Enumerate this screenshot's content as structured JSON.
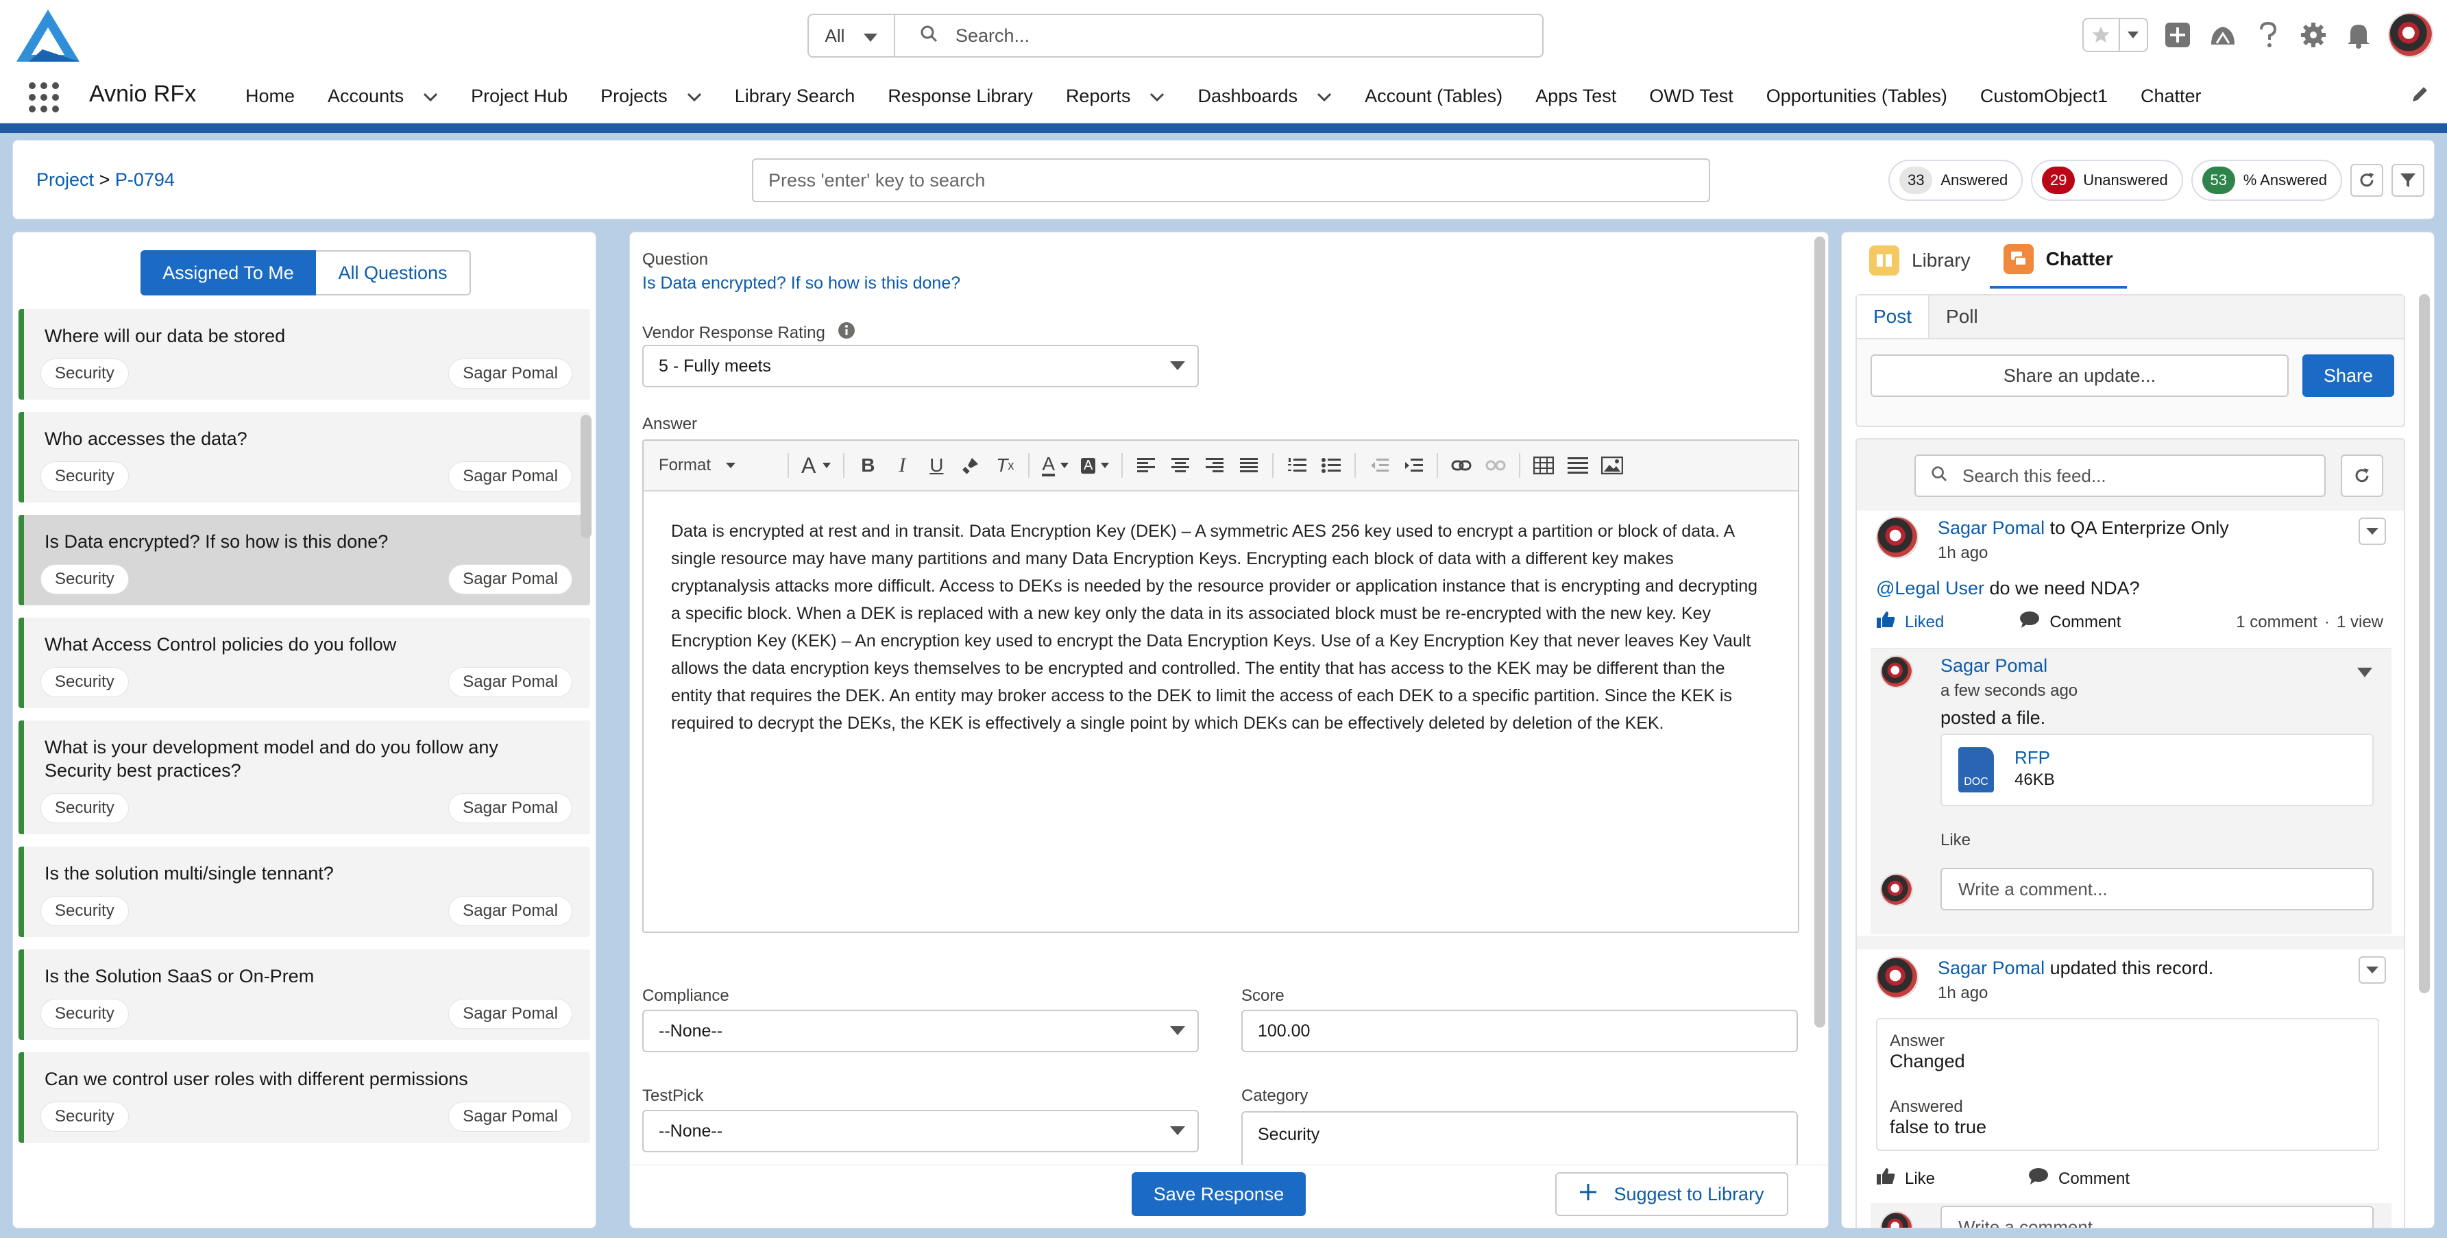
{
  "header": {
    "search_scope": "All",
    "search_placeholder": "Search...",
    "app_name": "Avnio RFx",
    "nav": [
      {
        "label": "Home",
        "dropdown": false
      },
      {
        "label": "Accounts",
        "dropdown": true
      },
      {
        "label": "Project Hub",
        "dropdown": false
      },
      {
        "label": "Projects",
        "dropdown": true
      },
      {
        "label": "Library Search",
        "dropdown": false
      },
      {
        "label": "Response Library",
        "dropdown": false
      },
      {
        "label": "Reports",
        "dropdown": true
      },
      {
        "label": "Dashboards",
        "dropdown": true
      },
      {
        "label": "Account (Tables)",
        "dropdown": false
      },
      {
        "label": "Apps Test",
        "dropdown": false
      },
      {
        "label": "OWD Test",
        "dropdown": false
      },
      {
        "label": "Opportunities (Tables)",
        "dropdown": false
      },
      {
        "label": "CustomObject1",
        "dropdown": false
      },
      {
        "label": "Chatter",
        "dropdown": false
      }
    ]
  },
  "topbar": {
    "breadcrumb_root": "Project",
    "breadcrumb_sep": ">",
    "breadcrumb_current": "P-0794",
    "search_placeholder": "Press 'enter' key to search",
    "answered_count": "33",
    "answered_label": "Answered",
    "unanswered_count": "29",
    "unanswered_label": "Unanswered",
    "pct_count": "53",
    "pct_label": "% Answered",
    "colors": {
      "answered": "#e5e5e5",
      "unanswered": "#ba0517",
      "pct": "#2e844a"
    }
  },
  "left": {
    "tab_assigned": "Assigned To Me",
    "tab_all": "All Questions",
    "questions": [
      {
        "text": "Where will our data be stored",
        "category": "Security",
        "owner": "Sagar Pomal",
        "selected": false
      },
      {
        "text": "Who accesses the data?",
        "category": "Security",
        "owner": "Sagar Pomal",
        "selected": false
      },
      {
        "text": "Is Data encrypted? If so how is this done?",
        "category": "Security",
        "owner": "Sagar Pomal",
        "selected": true
      },
      {
        "text": "What Access Control policies do you follow",
        "category": "Security",
        "owner": "Sagar Pomal",
        "selected": false
      },
      {
        "text": "What is your development model and do you follow any Security best practices?",
        "category": "Security",
        "owner": "Sagar Pomal",
        "selected": false
      },
      {
        "text": "Is the solution multi/single tennant?",
        "category": "Security",
        "owner": "Sagar Pomal",
        "selected": false
      },
      {
        "text": "Is the Solution SaaS or On-Prem",
        "category": "Security",
        "owner": "Sagar Pomal",
        "selected": false
      },
      {
        "text": "Can we control user roles with different permissions",
        "category": "Security",
        "owner": "Sagar Pomal",
        "selected": false
      }
    ]
  },
  "middle": {
    "question_label": "Question",
    "question_text": "Is Data encrypted? If so how is this done?",
    "rating_label": "Vendor Response Rating",
    "rating_value": "5 - Fully meets",
    "answer_label": "Answer",
    "toolbar_format": "Format",
    "answer_text": "Data is encrypted at rest and in transit. Data Encryption Key (DEK) – A symmetric AES 256 key used to encrypt a partition or block of data. A single resource may have many partitions and many Data Encryption Keys. Encrypting each block of data with a different key makes cryptanalysis attacks more difficult. Access to DEKs is needed by the resource provider or application instance that is encrypting and decrypting a specific block. When a DEK is replaced with a new key only the data in its associated block must be re-encrypted with the new key. Key Encryption Key (KEK) – An encryption key used to encrypt the Data Encryption Keys. Use of a Key Encryption Key that never leaves Key Vault allows the data encryption keys themselves to be encrypted and controlled. The entity that has access to the KEK may be different than the entity that requires the DEK. An entity may broker access to the DEK to limit the access of each DEK to a specific partition. Since the KEK is required to decrypt the DEKs, the KEK is effectively a single point by which DEKs can be effectively deleted by deletion of the KEK.",
    "compliance_label": "Compliance",
    "compliance_value": "--None--",
    "score_label": "Score",
    "score_value": "100.00",
    "testpick_label": "TestPick",
    "testpick_value": "--None--",
    "category_label": "Category",
    "category_value": "Security",
    "save_label": "Save Response",
    "suggest_label": "Suggest to Library"
  },
  "right": {
    "tab_library": "Library",
    "tab_chatter": "Chatter",
    "post_tab": "Post",
    "poll_tab": "Poll",
    "share_placeholder": "Share an update...",
    "share_button": "Share",
    "feed_search_placeholder": "Search this feed...",
    "post1": {
      "author": "Sagar Pomal",
      "target": "to QA Enterprize Only",
      "time": "1h ago",
      "mention": "@Legal User",
      "body": "do we need NDA?",
      "liked": "Liked",
      "comment": "Comment",
      "comments_count": "1 comment",
      "dot": "·",
      "views": "1 view"
    },
    "reply": {
      "author": "Sagar Pomal",
      "time": "a few seconds ago",
      "body": "posted a file.",
      "file_name": "RFP",
      "file_size": "46KB",
      "file_type": "DOC",
      "like": "Like"
    },
    "comment_placeholder": "Write a comment...",
    "post2": {
      "author": "Sagar Pomal",
      "action": "updated this record.",
      "time": "1h ago",
      "field1_label": "Answer",
      "field1_value": "Changed",
      "field2_label": "Answered",
      "field2_value": "false to true",
      "like": "Like",
      "comment": "Comment"
    }
  }
}
